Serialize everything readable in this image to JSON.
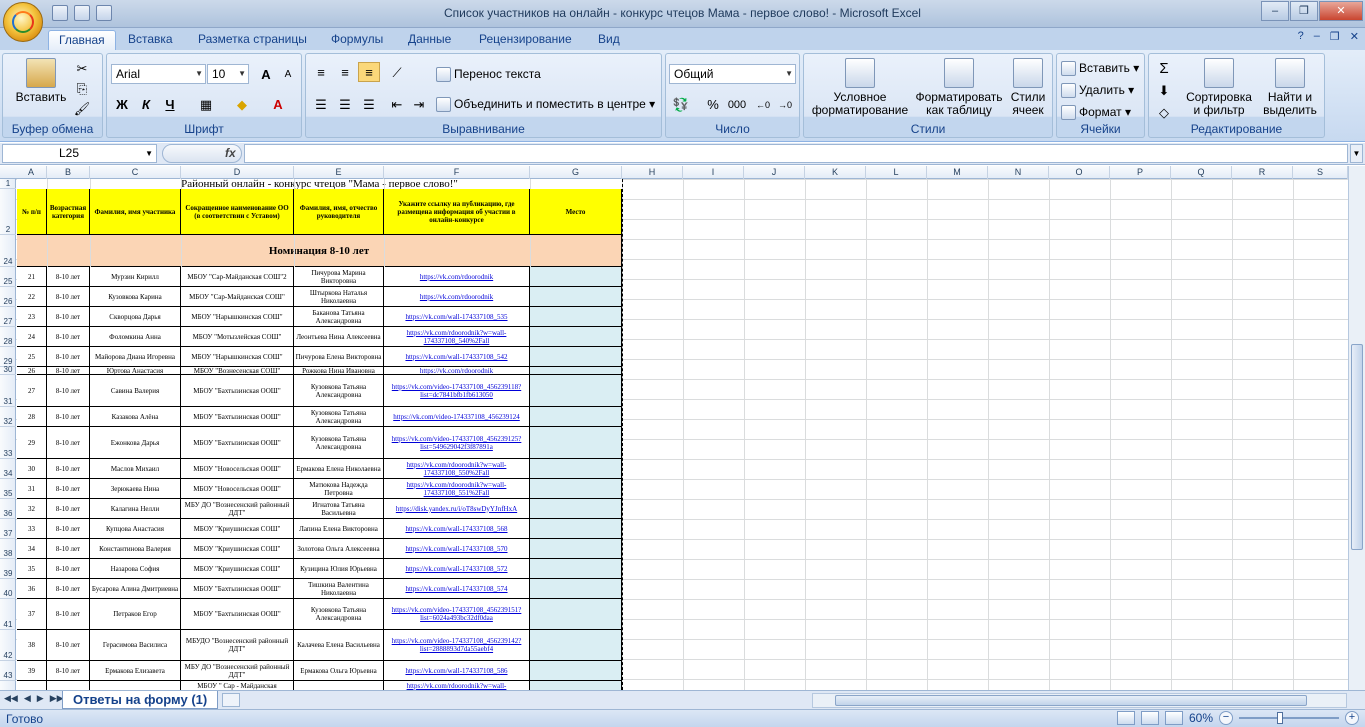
{
  "window": {
    "title": "Список участников на онлайн - конкурс чтецов Мама - первое слово! - Microsoft Excel"
  },
  "tabs": [
    "Главная",
    "Вставка",
    "Разметка страницы",
    "Формулы",
    "Данные",
    "Рецензирование",
    "Вид"
  ],
  "ribbon": {
    "clipboard": {
      "paste": "Вставить",
      "label": "Буфер обмена"
    },
    "font": {
      "name": "Arial",
      "size": "10",
      "bold": "Ж",
      "italic": "К",
      "underline": "Ч",
      "label": "Шрифт"
    },
    "align": {
      "wrap": "Перенос текста",
      "merge": "Объединить и поместить в центре",
      "label": "Выравнивание"
    },
    "number": {
      "format": "Общий",
      "percent": "%",
      "thousands": "000",
      "label": "Число"
    },
    "styles": {
      "conditional": "Условное форматирование",
      "astable": "Форматировать как таблицу",
      "cellstyles": "Стили ячеек",
      "label": "Стили"
    },
    "cells": {
      "insert": "Вставить",
      "delete": "Удалить",
      "format": "Формат",
      "label": "Ячейки"
    },
    "editing": {
      "sigma": "Σ",
      "sort": "Сортировка и фильтр",
      "find": "Найти и выделить",
      "label": "Редактирование"
    }
  },
  "formula_bar": {
    "namebox": "L25",
    "fx": "fx",
    "value": ""
  },
  "columns": [
    "A",
    "B",
    "C",
    "D",
    "E",
    "F",
    "G",
    "H",
    "I",
    "J",
    "K",
    "L",
    "M",
    "N",
    "O",
    "P",
    "Q",
    "R",
    "S"
  ],
  "rows_numbers": [
    "1",
    "2",
    "24",
    "25",
    "26",
    "27",
    "28",
    "29",
    "30",
    "31",
    "32",
    "33",
    "34",
    "35",
    "36",
    "37",
    "38",
    "39",
    "40",
    "41",
    "42",
    "43"
  ],
  "sheet": {
    "title": "Районный онлайн - конкурс чтецов \"Мама - первое слово!\"",
    "headers": [
      "№ п/п",
      "Возрастная категория",
      "Фамилия, имя участника",
      "Сокращенное наименование ОО (в соответствии с Уставом)",
      "Фамилия, имя, отчество руководителя",
      "Укажите ссылку на публикацию, где размещена информация об участии в онлайн-конкурсе",
      "Место"
    ],
    "nomination": "Номинация 8-10 лет",
    "rows": [
      [
        "21",
        "8-10 лет",
        "Мурзин Кирилл",
        "МБОУ \"Сар-Майданская СОШ\"2",
        "Пичурова Марина Викторовна",
        "https://vk.com/rdoorodnik"
      ],
      [
        "22",
        "8-10 лет",
        "Кузовкова Карина",
        "МБОУ \"Сар-Майданская СОШ\"",
        "Штыркова Наталья Николаевна",
        "https://vk.com/rdoorodnik"
      ],
      [
        "23",
        "8-10 лет",
        "Скворцова Дарья",
        "МБОУ \"Нарышкинская СОШ\"",
        "Баканова Татьяна Александровна",
        "https://vk.com/wall-174337108_535"
      ],
      [
        "24",
        "8-10 лет",
        "Фоломкина Анна",
        "МБОУ \"Мотызлейская СОШ\"",
        "Леонтьева Нина Алексеевна",
        "https://vk.com/rdoorodnik?w=wall-174337108_540%2Fall"
      ],
      [
        "25",
        "8-10 лет",
        "Майорова Диана Игоревна",
        "МБОУ \"Нарышкинская СОШ\"",
        "Пичурова Елена Викторовна",
        "https://vk.com/wall-174337108_542"
      ],
      [
        "26",
        "8-10 лет",
        "Юртова Анастасия",
        "МБОУ \"Вознесенская СОШ\"",
        "Рожкова Нина Ивановна",
        "https://vk.com/rdoorodnik"
      ],
      [
        "27",
        "8-10 лет",
        "Савина Валерия",
        "МБОУ \"Бахтызинская ООШ\"",
        "Кузовкова Татьяна Александровна",
        "https://vk.com/video-174337108_456239118?list=dc7841bfb1fb613050"
      ],
      [
        "28",
        "8-10 лет",
        "Казакова Алёна",
        "МБОУ \"Бахтызинская ООШ\"",
        "Кузовкова Татьяна Александровна",
        "https://vk.com/video-174337108_456239124"
      ],
      [
        "29",
        "8-10 лет",
        "Ежонкова Дарья",
        "МБОУ \"Бахтызинская ООШ\"",
        "Кузовкова Татьяна Александровна",
        "https://vk.com/video-174337108_456239125?list=549629042f3f87891a"
      ],
      [
        "30",
        "8-10 лет",
        "Маслов Михаил",
        "МБОУ \"Новосельская ООШ\"",
        "Ермакова Елена Николаевна",
        "https://vk.com/rdoorodnik?w=wall-174337108_550%2Fall"
      ],
      [
        "31",
        "8-10 лет",
        "Зерюкаева Нина",
        "МБОУ \"Новосельская ООШ\"",
        "Матюкова Надежда Петровна",
        "https://vk.com/rdoorodnik?w=wall-174337108_551%2Fall"
      ],
      [
        "32",
        "8-10 лет",
        "Калагина Нелли",
        "МБУ ДО \"Вознесенский районный ДДТ\"",
        "Игнатова Татьяна Васильевна",
        "https://disk.yandex.ru/i/oT8swDyYJnfHxA"
      ],
      [
        "33",
        "8-10 лет",
        "Купцова Анастасия",
        "МБОУ \"Криушинская СОШ\"",
        "Лапина Елена Викторовна",
        "https://vk.com/wall-174337108_568"
      ],
      [
        "34",
        "8-10 лет",
        "Константинова Валерия",
        "МБОУ \"Криушинская СОШ\"",
        "Золотова Ольга Алексеевна",
        "https://vk.com/wall-174337108_570"
      ],
      [
        "35",
        "8-10 лет",
        "Назарова София",
        "МБОУ \"Криушинская СОШ\"",
        "Кузицина Юлия Юрьевна",
        "https://vk.com/wall-174337108_572"
      ],
      [
        "36",
        "8-10 лет",
        "Бусарова Алина Дмитриевна",
        "МБОУ \"Бахтызинская ООШ\"",
        "Тишкина Валентина Николаевна",
        "https://vk.com/wall-174337108_574"
      ],
      [
        "37",
        "8-10 лет",
        "Петраков Егор",
        "МБОУ \"Бахтызинская ООШ\"",
        "Кузовкова Татьяна Александровна",
        "https://vk.com/video-174337108_456239151?list=6024a493bc32df0daa"
      ],
      [
        "38",
        "8-10 лет",
        "Герасимова Василиса",
        "МБУДО \"Вознесенский районный ДДТ\"",
        "Калачева Елена Васильевна",
        "https://vk.com/video-174337108_456239142?list=2888893d7da55aebf4"
      ],
      [
        "39",
        "8-10 лет",
        "Ермакова Елизавета",
        "МБУ ДО \"Вознесенский районный ДДТ\"",
        "Ермакова Ольга Юрьевна",
        "https://vk.com/wall-174337108_586"
      ],
      [
        "",
        "",
        "",
        "МБОУ \" Сар - Майданская",
        "",
        "https://vk.com/rdoorodnik?w=wall-"
      ]
    ]
  },
  "sheet_tab": "Ответы на форму (1)",
  "status": {
    "ready": "Готово",
    "zoom": "60%"
  }
}
